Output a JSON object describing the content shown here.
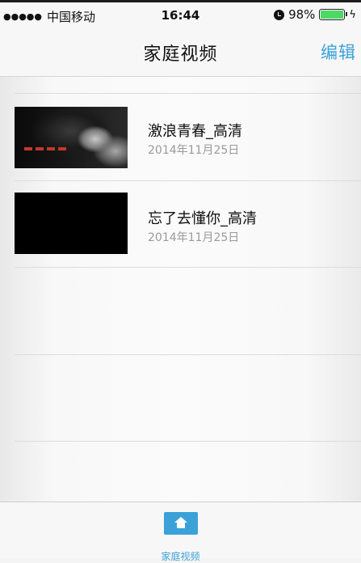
{
  "status_bar": {
    "signal_dots": "●●●●●",
    "carrier": "中国移动",
    "time": "16:44",
    "battery_percent": "98%",
    "battery_level": 0.98,
    "icons": [
      "signal-icon",
      "alarm-icon",
      "battery-icon",
      "charging-icon"
    ]
  },
  "nav": {
    "title": "家庭视频",
    "edit_label": "编辑"
  },
  "videos": [
    {
      "title": "激浪青春_高清",
      "date": "2014年11月25日",
      "thumbnail": "dragon-sculpture"
    },
    {
      "title": "忘了去懂你_高清",
      "date": "2014年11月25日",
      "thumbnail": "black"
    }
  ],
  "tab_bar": {
    "items": [
      {
        "label": "家庭视频",
        "icon": "home-icon",
        "selected": true
      }
    ]
  },
  "colors": {
    "accent": "#3ba1d8",
    "battery_green": "#4cd964",
    "date_gray": "#9a9a9a"
  }
}
